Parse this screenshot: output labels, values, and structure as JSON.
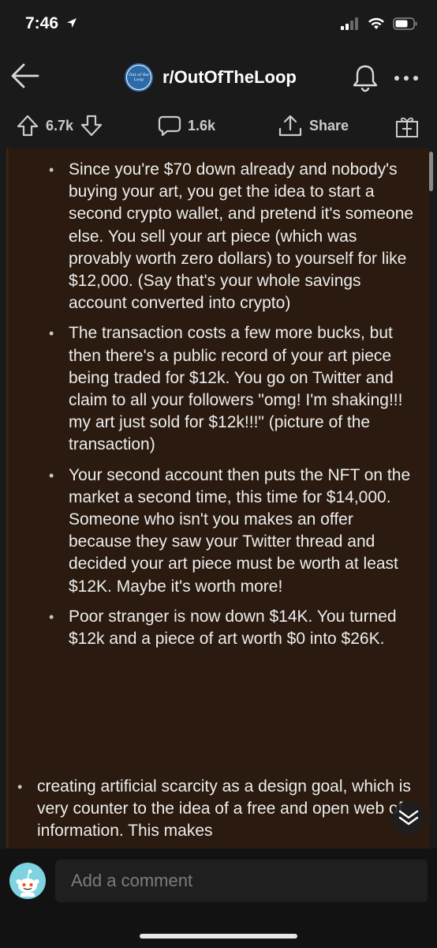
{
  "status_bar": {
    "time": "7:46"
  },
  "nav": {
    "subreddit": "r/OutOfTheLoop",
    "avatar_text": "Out of the Loop"
  },
  "actions": {
    "upvotes": "6.7k",
    "comments": "1.6k",
    "share_label": "Share"
  },
  "comment_body": {
    "nested_bullets": [
      "Since you're $70 down already and nobody's buying your art, you get the idea to start a second crypto wallet, and pretend it's someone else. You sell your art piece (which was provably worth zero dollars) to yourself for like $12,000. (Say that's your whole savings account converted into crypto)",
      "The transaction costs a few more bucks, but then there's a public record of your art piece being traded for $12k. You go on Twitter and claim to all your followers \"omg! I'm shaking!!! my art just sold for $12k!!!\" (picture of the transaction)",
      "Your second account then puts the NFT on the market a second time, this time for $14,000. Someone who isn't you makes an offer because they saw your Twitter thread and decided your art piece must be worth at least $12K. Maybe it's worth more!",
      "Poor stranger is now down $14K. You turned $12k and a piece of art worth $0 into $26K."
    ],
    "top_bullets": [
      "creating artificial scarcity as a design goal, which is very counter to the idea of a free and open web of information. This makes"
    ]
  },
  "comment_input": {
    "placeholder": "Add a comment"
  },
  "colors": {
    "background": "#1a1a1b",
    "content_background": "#2a1a0f",
    "text": "#ededed"
  }
}
